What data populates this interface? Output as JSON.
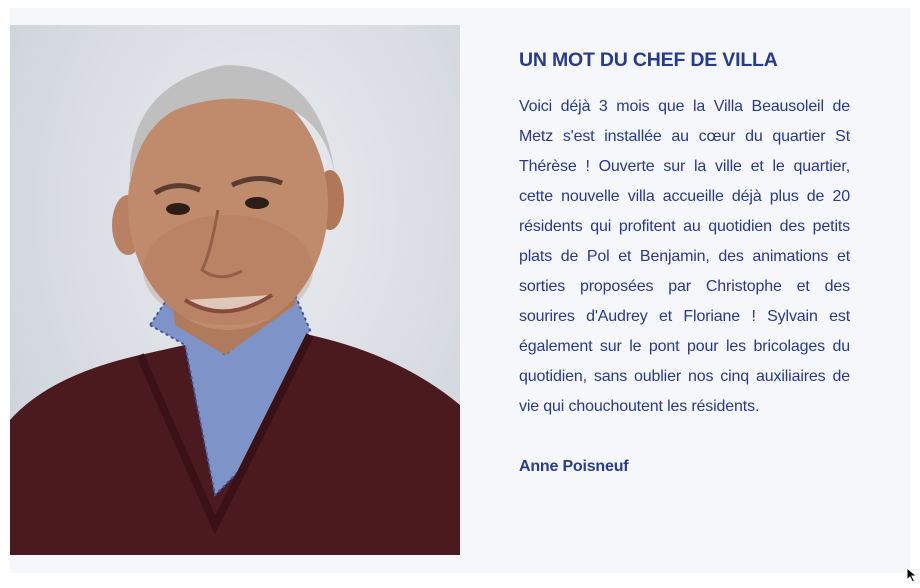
{
  "section": {
    "heading": "UN MOT DU CHEF DE VILLA",
    "body": "Voici déjà 3 mois que la Villa Beausoleil de Metz s'est installée au cœur du quartier St Thérèse ! Ouverte sur la ville et le quartier, cette nouvelle villa accueille déjà plus de 20 résidents qui profitent au quotidien des petits plats de Pol et Benjamin, des animations et sorties proposées par Christophe et des sourires d'Audrey et Floriane ! Sylvain est également sur le pont pour les bricolages du quotidien, sans oublier nos cinq auxiliaires de vie qui chouchoutent les résidents.",
    "signature": "Anne Poisneuf"
  },
  "colors": {
    "accent": "#263b8e",
    "card_background": "#f6f7fb"
  },
  "icons": {
    "cursor": "mouse-pointer-icon"
  }
}
